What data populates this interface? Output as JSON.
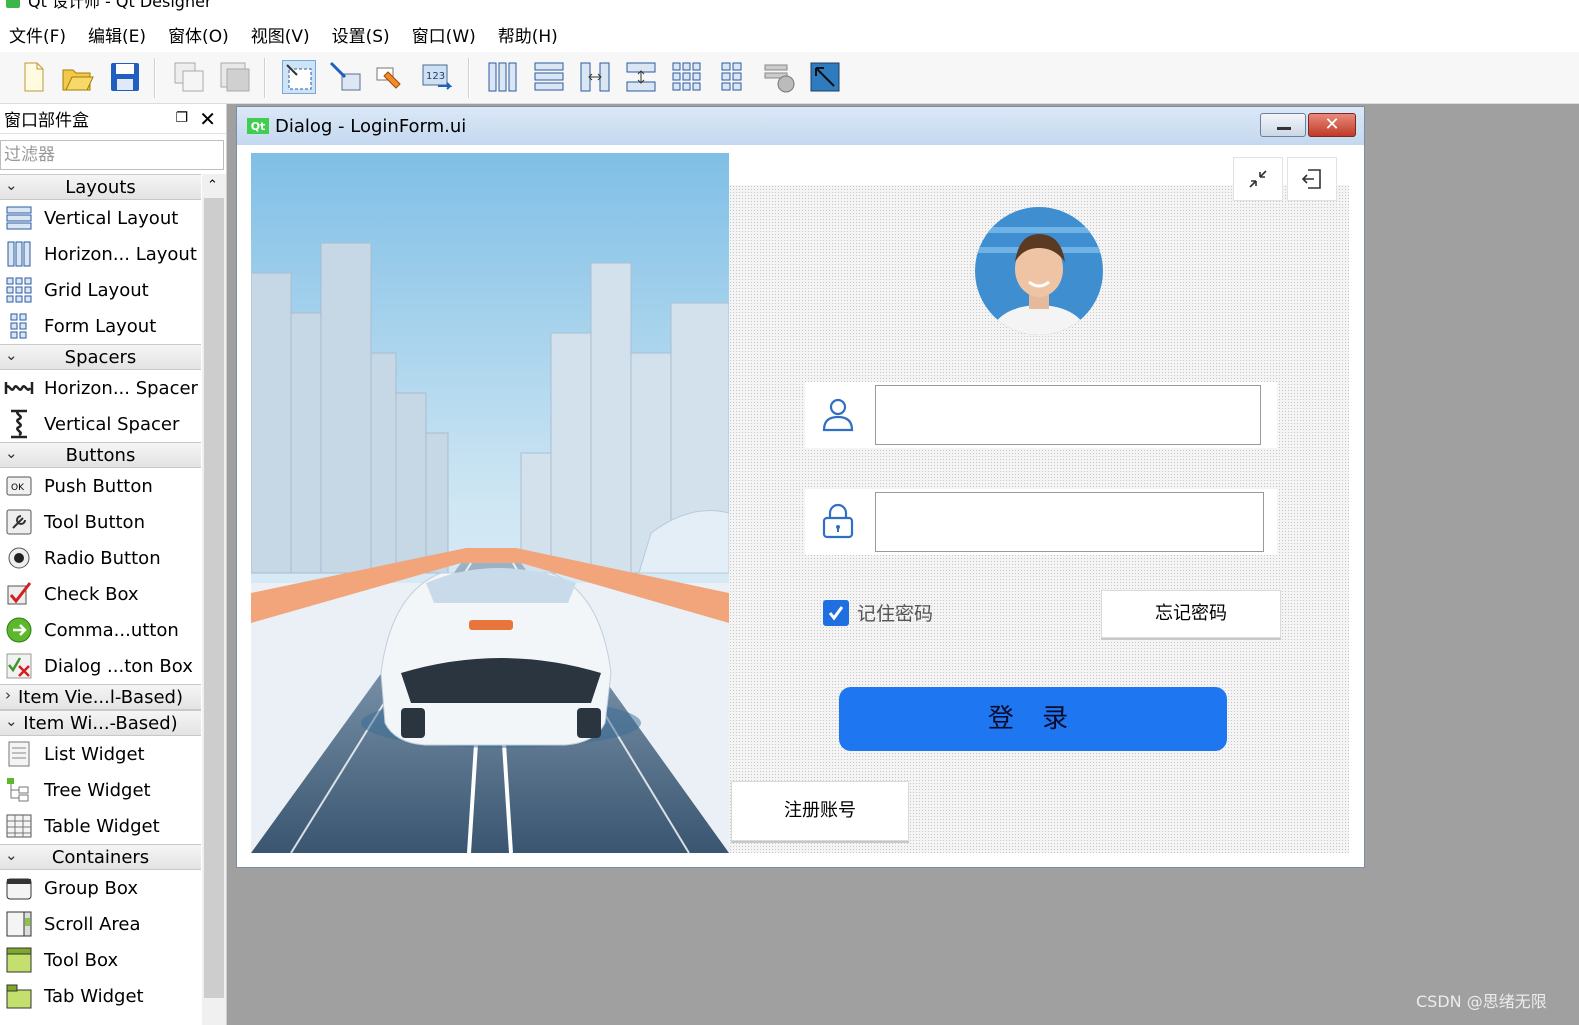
{
  "app": {
    "window_title": "Qt 设计师 - Qt Designer"
  },
  "menubar": {
    "items": [
      "文件(F)",
      "编辑(E)",
      "窗体(O)",
      "视图(V)",
      "设置(S)",
      "窗口(W)",
      "帮助(H)"
    ]
  },
  "toolbar": {
    "buttons": [
      "new-file-icon",
      "open-folder-icon",
      "save-icon",
      "copy-icon",
      "paste-icon",
      "edit-widgets-icon",
      "edit-signals-slots-icon",
      "edit-buddies-icon",
      "edit-tab-order-icon",
      "layout-horizontal-icon",
      "layout-vertical-icon",
      "layout-horizontal-splitter-icon",
      "layout-vertical-splitter-icon",
      "layout-grid-icon",
      "layout-form-icon",
      "break-layout-icon",
      "adjust-size-icon"
    ]
  },
  "widgetbox": {
    "title": "窗口部件盒",
    "filter_placeholder": "过滤器",
    "categories": {
      "layouts": "Layouts",
      "spacers": "Spacers",
      "buttons": "Buttons",
      "item_views": "Item Vie...l-Based)",
      "item_widgets": "Item Wi...-Based)",
      "containers": "Containers"
    },
    "items": {
      "vertical_layout": "Vertical Layout",
      "horizontal_layout": "Horizon... Layout",
      "grid_layout": "Grid Layout",
      "form_layout": "Form Layout",
      "horizontal_spacer": "Horizon... Spacer",
      "vertical_spacer": "Vertical Spacer",
      "push_button": "Push Button",
      "tool_button": "Tool Button",
      "radio_button": "Radio Button",
      "check_box": "Check Box",
      "command_link_button": "Comma...utton",
      "dialog_button_box": "Dialog ...ton Box",
      "list_widget": "List Widget",
      "tree_widget": "Tree Widget",
      "table_widget": "Table Widget",
      "group_box": "Group Box",
      "scroll_area": "Scroll Area",
      "tool_box": "Tool Box",
      "tab_widget": "Tab Widget"
    }
  },
  "dialog": {
    "title": "Dialog - LoginForm.ui",
    "qt_badge": "Qt"
  },
  "login_form": {
    "remember_label": "记住密码",
    "remember_checked": true,
    "forgot_button": "忘记密码",
    "login_button": "登 录",
    "register_button": "注册账号",
    "username_value": "",
    "password_value": ""
  },
  "watermark": "CSDN @思绪无限",
  "colors": {
    "login_button": "#1e76f0",
    "checkbox": "#1f6fe0",
    "icon_blue": "#2f6fc4"
  }
}
